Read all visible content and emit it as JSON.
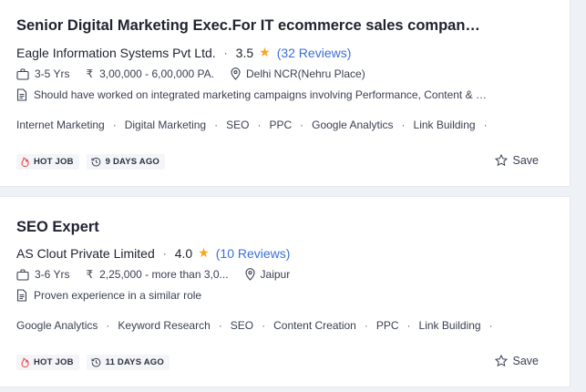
{
  "jobs": [
    {
      "title": "Senior Digital Marketing Exec.For IT ecommerce sales company at D...",
      "company": "Eagle Information Systems Pvt Ltd.",
      "rating": "3.5",
      "reviews": "(32 Reviews)",
      "experience": "3-5 Yrs",
      "salary": "3,00,000 - 6,00,000 PA.",
      "location": "Delhi NCR(Nehru Place)",
      "description": "Should have worked on integrated marketing campaigns involving Performance, Content & S...",
      "tags": [
        "Internet Marketing",
        "Digital Marketing",
        "SEO",
        "PPC",
        "Google Analytics",
        "Link Building"
      ],
      "hot_label": "HOT JOB",
      "posted": "9 DAYS AGO",
      "save_label": "Save"
    },
    {
      "title": "SEO Expert",
      "company": "AS Clout Private Limited",
      "rating": "4.0",
      "reviews": "(10 Reviews)",
      "experience": "3-6 Yrs",
      "salary": "2,25,000 - more than 3,0...",
      "location": "Jaipur",
      "description": "Proven experience in a similar role",
      "tags": [
        "Google Analytics",
        "Keyword Research",
        "SEO",
        "Content Creation",
        "PPC",
        "Link Building"
      ],
      "hot_label": "HOT JOB",
      "posted": "11 DAYS AGO",
      "save_label": "Save"
    }
  ],
  "symbols": {
    "rupee": "₹",
    "star": "★",
    "separator": "·"
  },
  "colors": {
    "star": "#f5a623",
    "reviews_link": "#3a6fd8",
    "hot_icon": "#e5484d"
  }
}
